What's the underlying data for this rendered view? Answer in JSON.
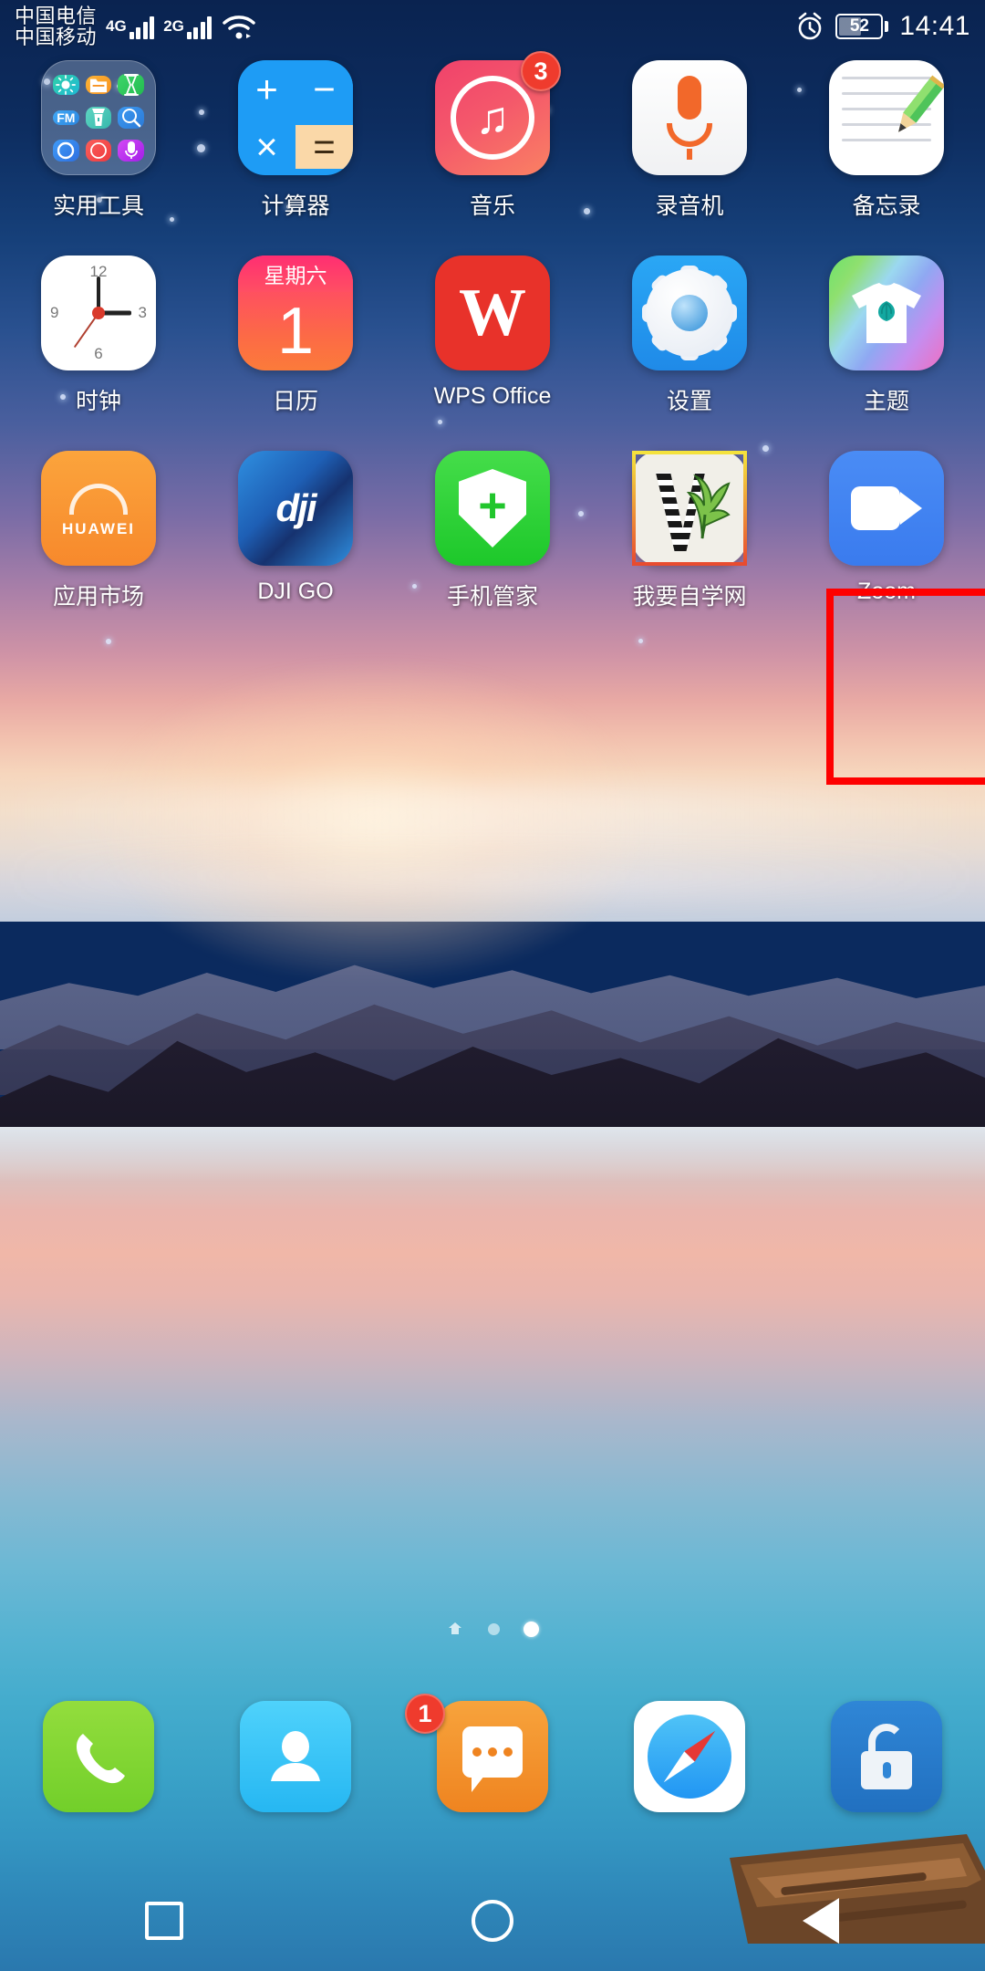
{
  "status_bar": {
    "carrier_1": "中国电信",
    "carrier_2": "中国移动",
    "network_1": "4G",
    "network_2": "2G",
    "wifi_icon": "wifi-icon",
    "alarm_icon": "alarm-clock-icon",
    "battery_percent": "52",
    "clock": "14:41"
  },
  "home_screen": {
    "rows": [
      {
        "apps": [
          {
            "label": "实用工具",
            "icon": "folder-utilities-icon",
            "badge": ""
          },
          {
            "label": "计算器",
            "icon": "calculator-icon",
            "badge": ""
          },
          {
            "label": "音乐",
            "icon": "music-icon",
            "badge": "3"
          },
          {
            "label": "录音机",
            "icon": "voice-recorder-icon",
            "badge": ""
          },
          {
            "label": "备忘录",
            "icon": "notes-icon",
            "badge": ""
          }
        ]
      },
      {
        "apps": [
          {
            "label": "时钟",
            "icon": "clock-icon",
            "badge": ""
          },
          {
            "label": "日历",
            "icon": "calendar-icon",
            "badge": ""
          },
          {
            "label": "WPS Office",
            "icon": "wps-office-icon",
            "badge": ""
          },
          {
            "label": "设置",
            "icon": "settings-gear-icon",
            "badge": ""
          },
          {
            "label": "主题",
            "icon": "themes-icon",
            "badge": ""
          }
        ]
      },
      {
        "apps": [
          {
            "label": "应用市场",
            "icon": "huawei-appgallery-icon",
            "badge": ""
          },
          {
            "label": "DJI GO",
            "icon": "dji-go-icon",
            "badge": ""
          },
          {
            "label": "手机管家",
            "icon": "phone-manager-icon",
            "badge": ""
          },
          {
            "label": "我要自学网",
            "icon": "self-study-net-icon",
            "badge": ""
          },
          {
            "label": "Zoom",
            "icon": "zoom-video-icon",
            "badge": ""
          }
        ]
      }
    ],
    "folder_mini_icons": [
      "brightness-icon",
      "file-manager-icon",
      "hourglass-icon",
      "fm-radio-icon",
      "flashlight-icon",
      "magnifier-icon",
      "compass-ring-icon",
      "safari-compass-icon",
      "mic-icon"
    ],
    "calendar_weekday": "星期六",
    "calendar_day": "1",
    "wps_letter": "W",
    "huawei_store_text": "HUAWEI",
    "dji_text": "dji",
    "clock_numerals": {
      "n12": "12",
      "n3": "3",
      "n6": "6",
      "n9": "9"
    }
  },
  "highlight": {
    "target_app": "Zoom",
    "color": "#fe0000"
  },
  "page_indicator": {
    "dots": [
      "home",
      "inactive",
      "active"
    ],
    "active_index": 2
  },
  "dock": {
    "items": [
      {
        "label": "phone",
        "icon": "phone-handset-icon",
        "badge": ""
      },
      {
        "label": "contacts",
        "icon": "contacts-person-icon",
        "badge": ""
      },
      {
        "label": "messages",
        "icon": "message-bubble-icon",
        "badge": "1"
      },
      {
        "label": "browser",
        "icon": "browser-compass-icon",
        "badge": ""
      },
      {
        "label": "lock",
        "icon": "padlock-icon",
        "badge": ""
      }
    ]
  },
  "nav_bar": {
    "recents": "recents-square-icon",
    "home": "home-circle-icon",
    "back": "back-triangle-icon"
  },
  "colors": {
    "highlight_red": "#fe0000",
    "badge_red": "#ef3b2d",
    "accent_blue": "#4a8cf5"
  }
}
